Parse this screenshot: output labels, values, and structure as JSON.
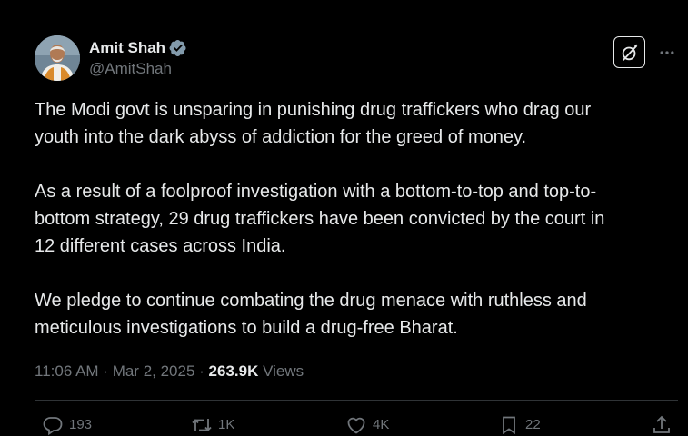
{
  "author": {
    "display_name": "Amit Shah",
    "handle": "@AmitShah",
    "verified": true
  },
  "tweet": {
    "paragraphs": [
      [
        "The Modi govt is unsparing in punishing drug traffickers who drag our",
        "youth into the dark abyss of addiction for the greed of money."
      ],
      [
        "As a result of a foolproof investigation with a bottom-to-top and top-to-",
        "bottom strategy, 29 drug traffickers have been convicted by the court in",
        "12 different cases across India."
      ],
      [
        "We pledge to continue combating the drug menace with ruthless and",
        "meticulous investigations to build a drug-free Bharat."
      ]
    ]
  },
  "meta": {
    "time": "11:06 AM",
    "separator1": " · ",
    "date": "Mar 2, 2025",
    "separator2": " · ",
    "views_count": "263.9K",
    "views_label": " Views"
  },
  "actions": {
    "replies": "193",
    "reposts": "1K",
    "likes": "4K",
    "bookmarks": "22"
  },
  "icons": {
    "grok": "grok-icon",
    "more": "more-horizontal-icon",
    "verified": "verified-badge-icon",
    "reply": "reply-icon",
    "repost": "repost-icon",
    "like": "heart-icon",
    "bookmark": "bookmark-icon",
    "share": "share-icon"
  },
  "colors": {
    "background": "#000000",
    "text_primary": "#e7e9ea",
    "text_secondary": "#71767b",
    "border": "#2f3336"
  }
}
